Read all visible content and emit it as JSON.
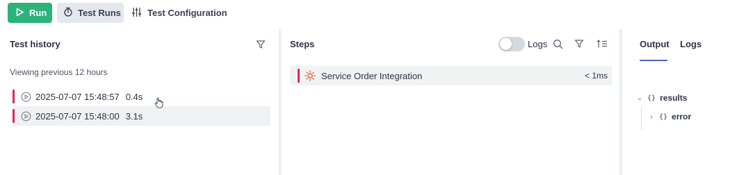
{
  "toolbar": {
    "run_label": "Run",
    "test_runs_label": "Test Runs",
    "test_config_label": "Test Configuration"
  },
  "history": {
    "title": "Test history",
    "subtitle": "Viewing previous 12 hours",
    "rows": [
      {
        "timestamp": "2025-07-07 15:48:57",
        "duration": "0.4s",
        "status_color": "#e5245a"
      },
      {
        "timestamp": "2025-07-07 15:48:00",
        "duration": "3.1s",
        "status_color": "#e5245a"
      }
    ]
  },
  "steps": {
    "title": "Steps",
    "logs_toggle_label": "Logs",
    "logs_toggle_on": false,
    "rows": [
      {
        "name": "Service Order Integration",
        "duration": "< 1ms"
      }
    ]
  },
  "output": {
    "tabs": [
      {
        "label": "Output",
        "active": true
      },
      {
        "label": "Logs",
        "active": false
      }
    ],
    "tree": {
      "root": {
        "label": "results",
        "expanded": true
      },
      "child": {
        "label": "error",
        "expanded": false
      }
    }
  },
  "colors": {
    "accent_green": "#2bb37a",
    "status_fail": "#e5245a",
    "tab_underline": "#4e66c9"
  }
}
